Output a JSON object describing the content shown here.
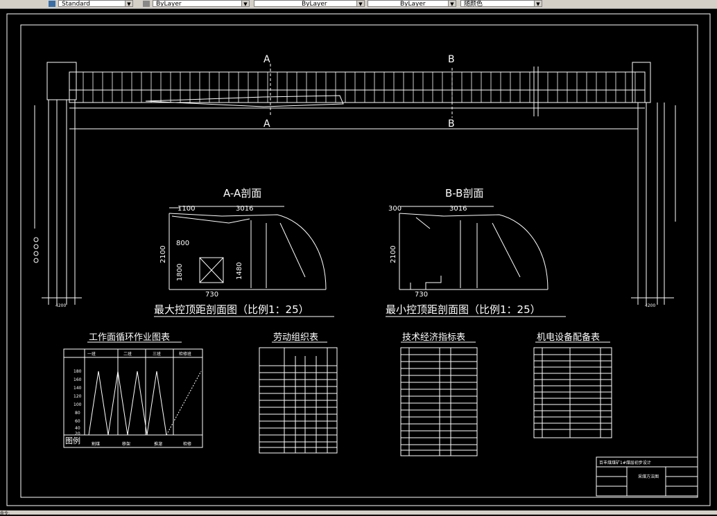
{
  "toolbar": {
    "textstyle": "Standard",
    "layer": "ByLayer",
    "linetype": "ByLayer",
    "lineweight": "ByLayer",
    "color": "随颜色"
  },
  "drawing": {
    "marker_a": "A",
    "marker_b": "B",
    "section_aa_title": "A-A剖面",
    "section_bb_title": "B-B剖面",
    "max_caption": "最大控顶距剖面图（比例1：25）",
    "min_caption": "最小控顶距剖面图（比例1：25）",
    "dims": {
      "aa_left": "1100",
      "aa_width": "3016",
      "aa_height": "2100",
      "aa_800": "800",
      "aa_1800": "1800",
      "aa_1480": "1480",
      "aa_730": "730",
      "bb_left": "300",
      "bb_width": "3016",
      "bb_height": "2100",
      "bb_730": "730",
      "left_4200": "4200",
      "right_4200": "4200"
    },
    "table_cycle_title": "工作面循环作业图表",
    "table_cycle_legend": "图例",
    "table_cycle_shifts": [
      "一班",
      "二班",
      "三班",
      "检修班"
    ],
    "table_cycle_axis": [
      "180",
      "160",
      "140",
      "120",
      "100",
      "80",
      "60",
      "40",
      "20"
    ],
    "table_cycle_ops": [
      "割煤",
      "移架",
      "推溜",
      "检修"
    ],
    "table_labor_title": "劳动组织表",
    "table_tech_title": "技术经济指标表",
    "table_equip_title": "机电设备配备表",
    "titleblock_line1": "百丰煤煤矿1#煤层初步设计",
    "titleblock_line2": "采煤方法图"
  },
  "status": {
    "command": "命令:"
  },
  "colors": {
    "bg": "#000000",
    "line": "#ffffff",
    "ui": "#d4d0c8"
  }
}
